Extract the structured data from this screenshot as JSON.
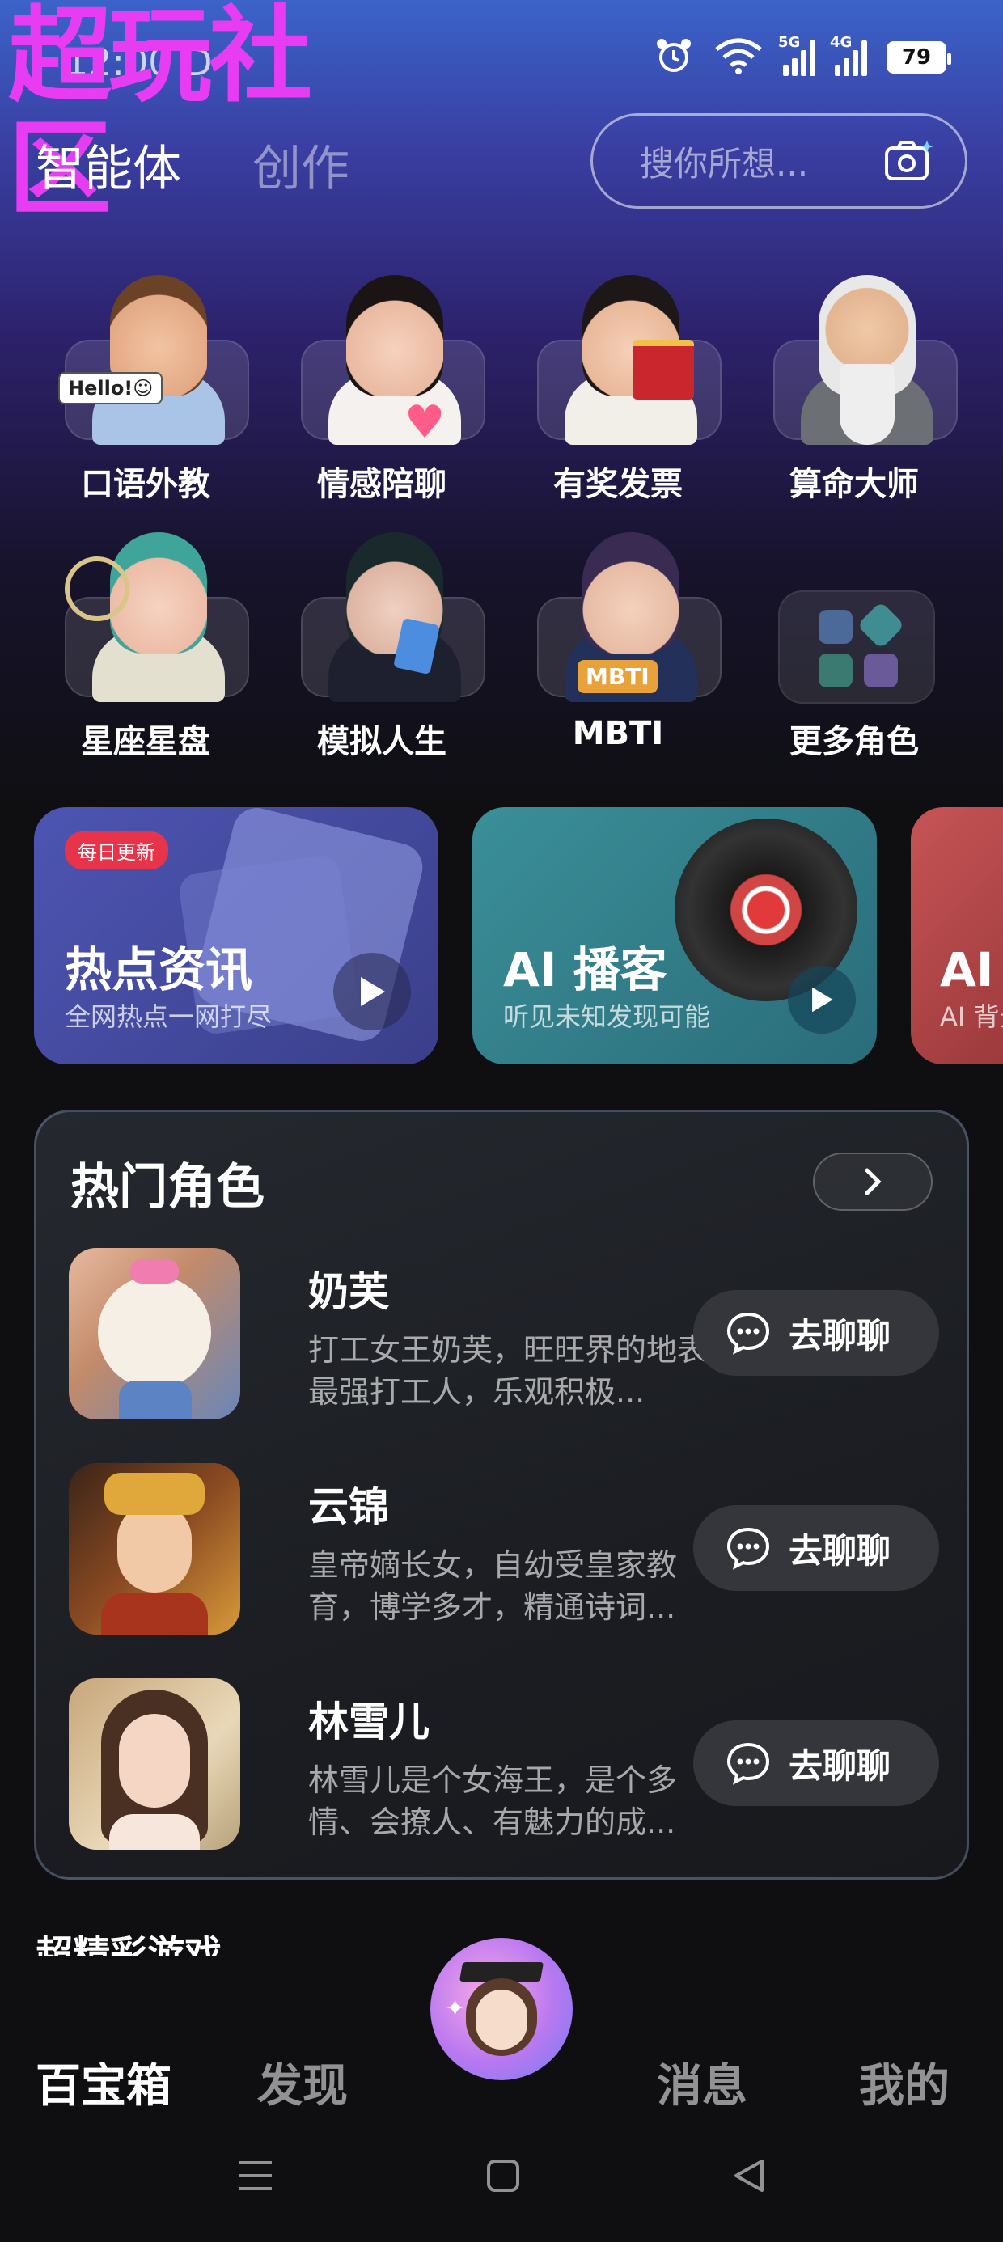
{
  "watermark": "超玩社区",
  "status_bar": {
    "time": "12:00 D",
    "network_labels": [
      "5G",
      "4G"
    ],
    "battery": "79",
    "icons": [
      "alarm-icon",
      "wifi-icon",
      "signal-5g-icon",
      "signal-4g-icon",
      "battery-icon"
    ]
  },
  "header": {
    "tabs": [
      {
        "label": "智能体",
        "active": true
      },
      {
        "label": "创作",
        "active": false
      }
    ],
    "search_placeholder": "搜你所想...",
    "search_icon": "camera-sparkle-icon"
  },
  "agents": [
    {
      "name": "口语外教",
      "badge": "Hello!☺"
    },
    {
      "name": "情感陪聊"
    },
    {
      "name": "有奖发票"
    },
    {
      "name": "算命大师"
    },
    {
      "name": "星座星盘"
    },
    {
      "name": "模拟人生"
    },
    {
      "name": "MBTI",
      "badge": "MBTI"
    },
    {
      "name": "更多角色"
    }
  ],
  "features": [
    {
      "tag": "每日更新",
      "title": "热点资讯",
      "subtitle": "全网热点一网打尽",
      "color": "#4a51a8"
    },
    {
      "title": "AI 播客",
      "subtitle": "听见未知发现可能",
      "color": "#2f7f8c"
    },
    {
      "title": "AI 有",
      "subtitle": "AI 背景",
      "color": "#b4494c"
    }
  ],
  "hot_roles": {
    "title": "热门角色",
    "more_icon": "chevron-right-icon",
    "chat_label": "去聊聊",
    "items": [
      {
        "name": "奶芙",
        "desc": "打工女王奶芙，旺旺界的地表最强打工人，乐观积极..."
      },
      {
        "name": "云锦",
        "desc": "皇帝嫡长女，自幼受皇家教育，博学多才，精通诗词..."
      },
      {
        "name": "林雪儿",
        "desc": "林雪儿是个女海王，是个多情、会撩人、有魅力的成..."
      }
    ]
  },
  "cut_heading": "超精彩游戏",
  "bottom_nav": [
    {
      "label": "百宝箱",
      "active": true
    },
    {
      "label": "发现",
      "active": false
    },
    {
      "label": "消息",
      "active": false
    },
    {
      "label": "我的",
      "active": false
    }
  ],
  "system_nav": [
    "menu-icon",
    "home-icon",
    "back-icon"
  ]
}
